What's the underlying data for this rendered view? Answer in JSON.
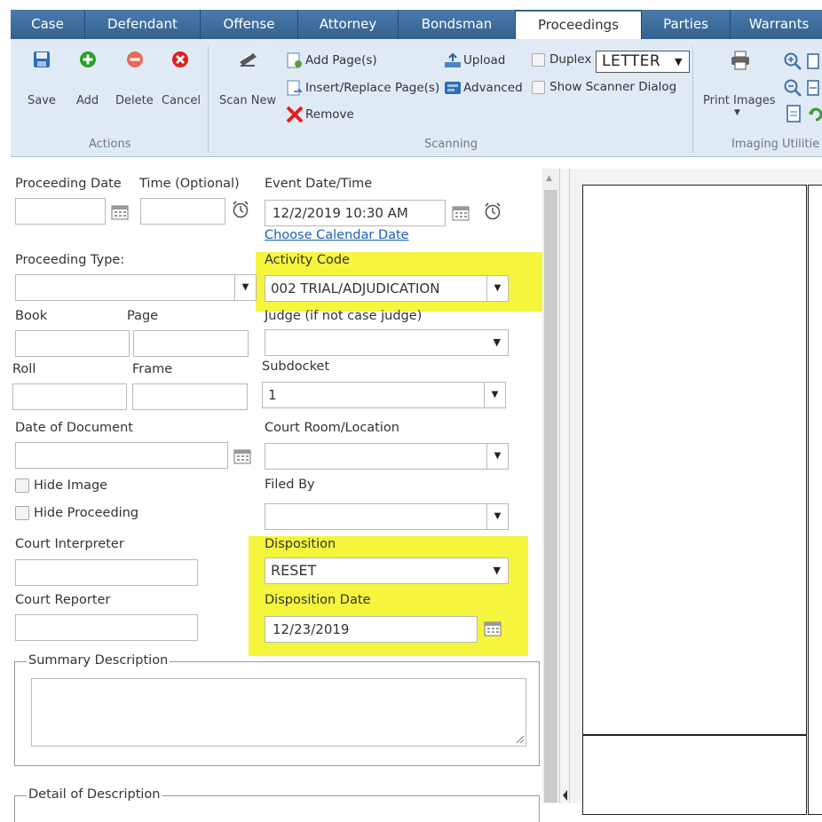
{
  "tabs": [
    "Case",
    "Defendant",
    "Offense",
    "Attorney",
    "Bondsman",
    "Proceedings",
    "Parties",
    "Warrants"
  ],
  "ribbon": {
    "actions": {
      "save": "Save",
      "add": "Add",
      "delete": "Delete",
      "cancel": "Cancel",
      "group": "Actions"
    },
    "scanning": {
      "scan_new": "Scan New",
      "add_pages": "Add Page(s)",
      "insert_replace": "Insert/Replace Page(s)",
      "remove": "Remove",
      "upload": "Upload",
      "advanced": "Advanced",
      "duplex": "Duplex",
      "paper_size": "LETTER",
      "show_scanner_dialog": "Show Scanner Dialog",
      "group": "Scanning"
    },
    "imaging": {
      "print_images": "Print Images",
      "group": "Imaging Utilitie"
    }
  },
  "form": {
    "proceeding_date": {
      "label": "Proceeding Date",
      "value": ""
    },
    "time_optional": {
      "label": "Time (Optional)",
      "value": ""
    },
    "event_datetime": {
      "label": "Event Date/Time",
      "value": "12/2/2019 10:30 AM"
    },
    "choose_calendar_date": "Choose Calendar Date",
    "proceeding_type": {
      "label": "Proceeding Type:",
      "value": ""
    },
    "activity_code": {
      "label": "Activity Code",
      "value": "002 TRIAL/ADJUDICATION"
    },
    "book": {
      "label": "Book",
      "value": ""
    },
    "page": {
      "label": "Page",
      "value": ""
    },
    "judge": {
      "label": "Judge (if not case judge)",
      "value": ""
    },
    "roll": {
      "label": "Roll",
      "value": ""
    },
    "frame": {
      "label": "Frame",
      "value": ""
    },
    "subdocket": {
      "label": "Subdocket",
      "value": "1"
    },
    "date_of_document": {
      "label": "Date of Document",
      "value": ""
    },
    "court_room": {
      "label": "Court Room/Location",
      "value": ""
    },
    "hide_image": "Hide Image",
    "hide_proceeding": "Hide Proceeding",
    "filed_by": {
      "label": "Filed By",
      "value": ""
    },
    "court_interpreter": {
      "label": "Court Interpreter",
      "value": ""
    },
    "disposition": {
      "label": "Disposition",
      "value": "RESET"
    },
    "court_reporter": {
      "label": "Court Reporter",
      "value": ""
    },
    "disposition_date": {
      "label": "Disposition Date",
      "value": "12/23/2019"
    },
    "summary_description": "Summary Description",
    "detail_of_description": "Detail of Description"
  },
  "colors": {
    "tab_blue": "#3c6c9c",
    "ribbon_bg": "#dfeaf5",
    "highlight": "#f4f53c",
    "link": "#1a5fb4"
  }
}
